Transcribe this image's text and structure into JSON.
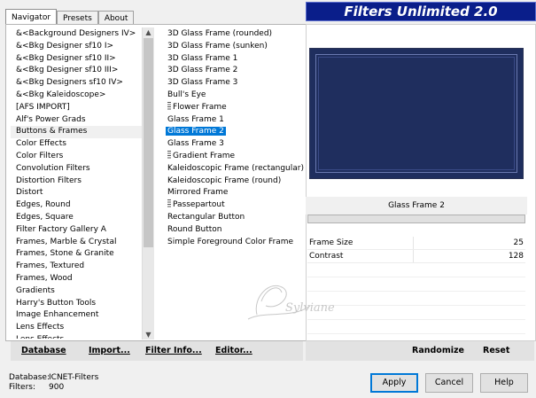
{
  "tabs": [
    "Navigator",
    "Presets",
    "About"
  ],
  "banner": "Filters Unlimited 2.0",
  "categories": [
    "&<Background Designers IV>",
    "&<Bkg Designer sf10 I>",
    "&<Bkg Designer sf10 II>",
    "&<Bkg Designer sf10 III>",
    "&<Bkg Designers sf10 IV>",
    "&<Bkg Kaleidoscope>",
    "[AFS IMPORT]",
    "Alf's Power Grads",
    "Buttons & Frames",
    "Color Effects",
    "Color Filters",
    "Convolution Filters",
    "Distortion Filters",
    "Distort",
    "Edges, Round",
    "Edges, Square",
    "Filter Factory Gallery A",
    "Frames, Marble & Crystal",
    "Frames, Stone & Granite",
    "Frames, Textured",
    "Frames, Wood",
    "Gradients",
    "Harry's Button Tools",
    "Image Enhancement",
    "Lens Effects",
    "Lens Effects"
  ],
  "selected_category": "Buttons & Frames",
  "filters": [
    {
      "label": "3D Glass Frame (rounded)",
      "group": false
    },
    {
      "label": "3D Glass Frame (sunken)",
      "group": false
    },
    {
      "label": "3D Glass Frame 1",
      "group": false
    },
    {
      "label": "3D Glass Frame 2",
      "group": false
    },
    {
      "label": "3D Glass Frame 3",
      "group": false
    },
    {
      "label": "Bull's Eye",
      "group": false
    },
    {
      "label": "Flower Frame",
      "group": true
    },
    {
      "label": "Glass Frame 1",
      "group": false
    },
    {
      "label": "Glass Frame 2",
      "group": false
    },
    {
      "label": "Glass Frame 3",
      "group": false
    },
    {
      "label": "Gradient Frame",
      "group": true
    },
    {
      "label": "Kaleidoscopic Frame (rectangular)",
      "group": false
    },
    {
      "label": "Kaleidoscopic Frame (round)",
      "group": false
    },
    {
      "label": "Mirrored Frame",
      "group": false
    },
    {
      "label": "Passepartout",
      "group": true
    },
    {
      "label": "Rectangular Button",
      "group": false
    },
    {
      "label": "Round Button",
      "group": false
    },
    {
      "label": "Simple Foreground Color Frame",
      "group": false
    }
  ],
  "selected_filter": "Glass Frame 2",
  "filter_name": "Glass Frame 2",
  "params": [
    {
      "name": "Frame Size",
      "value": "25"
    },
    {
      "name": "Contrast",
      "value": "128"
    }
  ],
  "left_buttons": {
    "database": "Database",
    "import": "Import...",
    "filter_info": "Filter Info...",
    "editor": "Editor..."
  },
  "right_buttons": {
    "randomize": "Randomize",
    "reset": "Reset"
  },
  "info": {
    "database_label": "Database:",
    "database_value": "ICNET-Filters",
    "filters_label": "Filters:",
    "filters_value": "900"
  },
  "dialog": {
    "apply": "Apply",
    "cancel": "Cancel",
    "help": "Help"
  },
  "watermark": "Sylviane",
  "colors": {
    "banner_bg": "#0a1e8a",
    "preview_bg": "#1f2e5e",
    "selection": "#0078d7"
  }
}
